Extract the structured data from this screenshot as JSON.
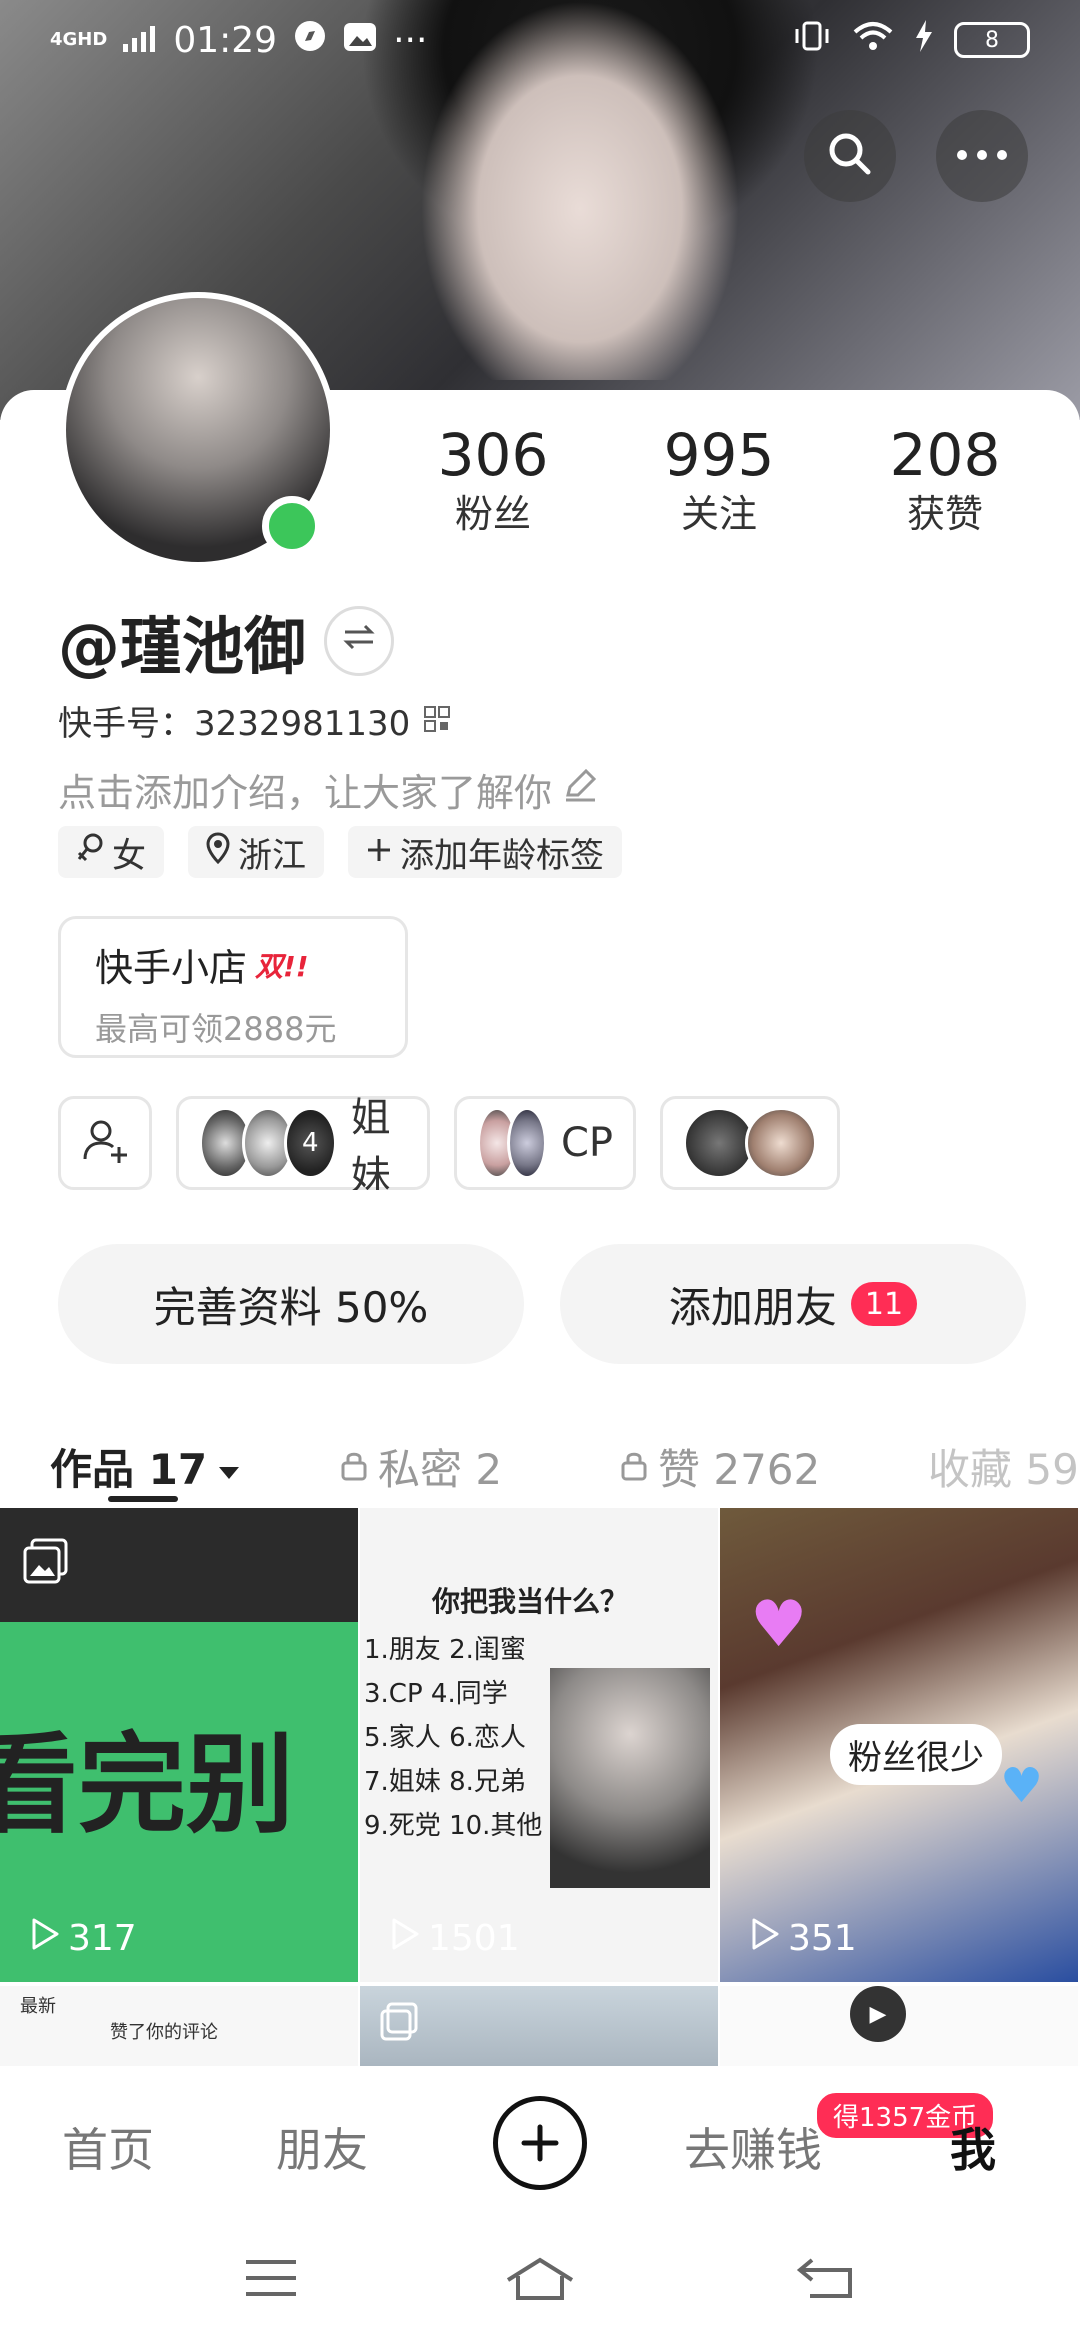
{
  "status_bar": {
    "network": "4GHD",
    "time": "01:29",
    "more": "···",
    "battery": "8"
  },
  "profile": {
    "stats": [
      {
        "num": "306",
        "label": "粉丝"
      },
      {
        "num": "995",
        "label": "关注"
      },
      {
        "num": "208",
        "label": "获赞"
      }
    ],
    "name": "@瑾池御",
    "kuaishou_id": "快手号：3232981130",
    "intro_placeholder": "点击添加介绍，让大家了解你",
    "tags": [
      {
        "icon": "female-icon",
        "label": "女"
      },
      {
        "icon": "location-icon",
        "label": "浙江"
      },
      {
        "icon": "plus-icon",
        "label": "添加年龄标签"
      }
    ]
  },
  "shop": {
    "title": "快手小店",
    "badge": "双!!",
    "subtitle": "最高可领2888元"
  },
  "groups": [
    {
      "label": "姐妹",
      "count": "4"
    },
    {
      "label": "CP"
    }
  ],
  "actions": {
    "complete_profile": "完善资料 50%",
    "add_friends": "添加朋友",
    "add_friends_badge": "11"
  },
  "tabs": [
    {
      "label": "作品 17",
      "active": true
    },
    {
      "label": "私密 2"
    },
    {
      "label": "赞 2762"
    },
    {
      "label": "收藏 59"
    }
  ],
  "grid": [
    {
      "overlay": "看完别",
      "plays": "317"
    },
    {
      "question": "你把我当什么？",
      "options": [
        "1.朋友  2.闺蜜",
        "3.CP   4.同学",
        "5.家人  6.恋人",
        "7.姐妹  8.兄弟",
        "9.死党  10.其他"
      ],
      "plays": "1501"
    },
    {
      "bubble": "粉丝很少",
      "plays": "351"
    }
  ],
  "row2": {
    "cell1_title": "最新",
    "cell1_text": "赞了你的评论"
  },
  "bottom_nav": {
    "home": "首页",
    "friends": "朋友",
    "earn": "去赚钱",
    "coin_badge": "得1357金币",
    "me": "我"
  }
}
